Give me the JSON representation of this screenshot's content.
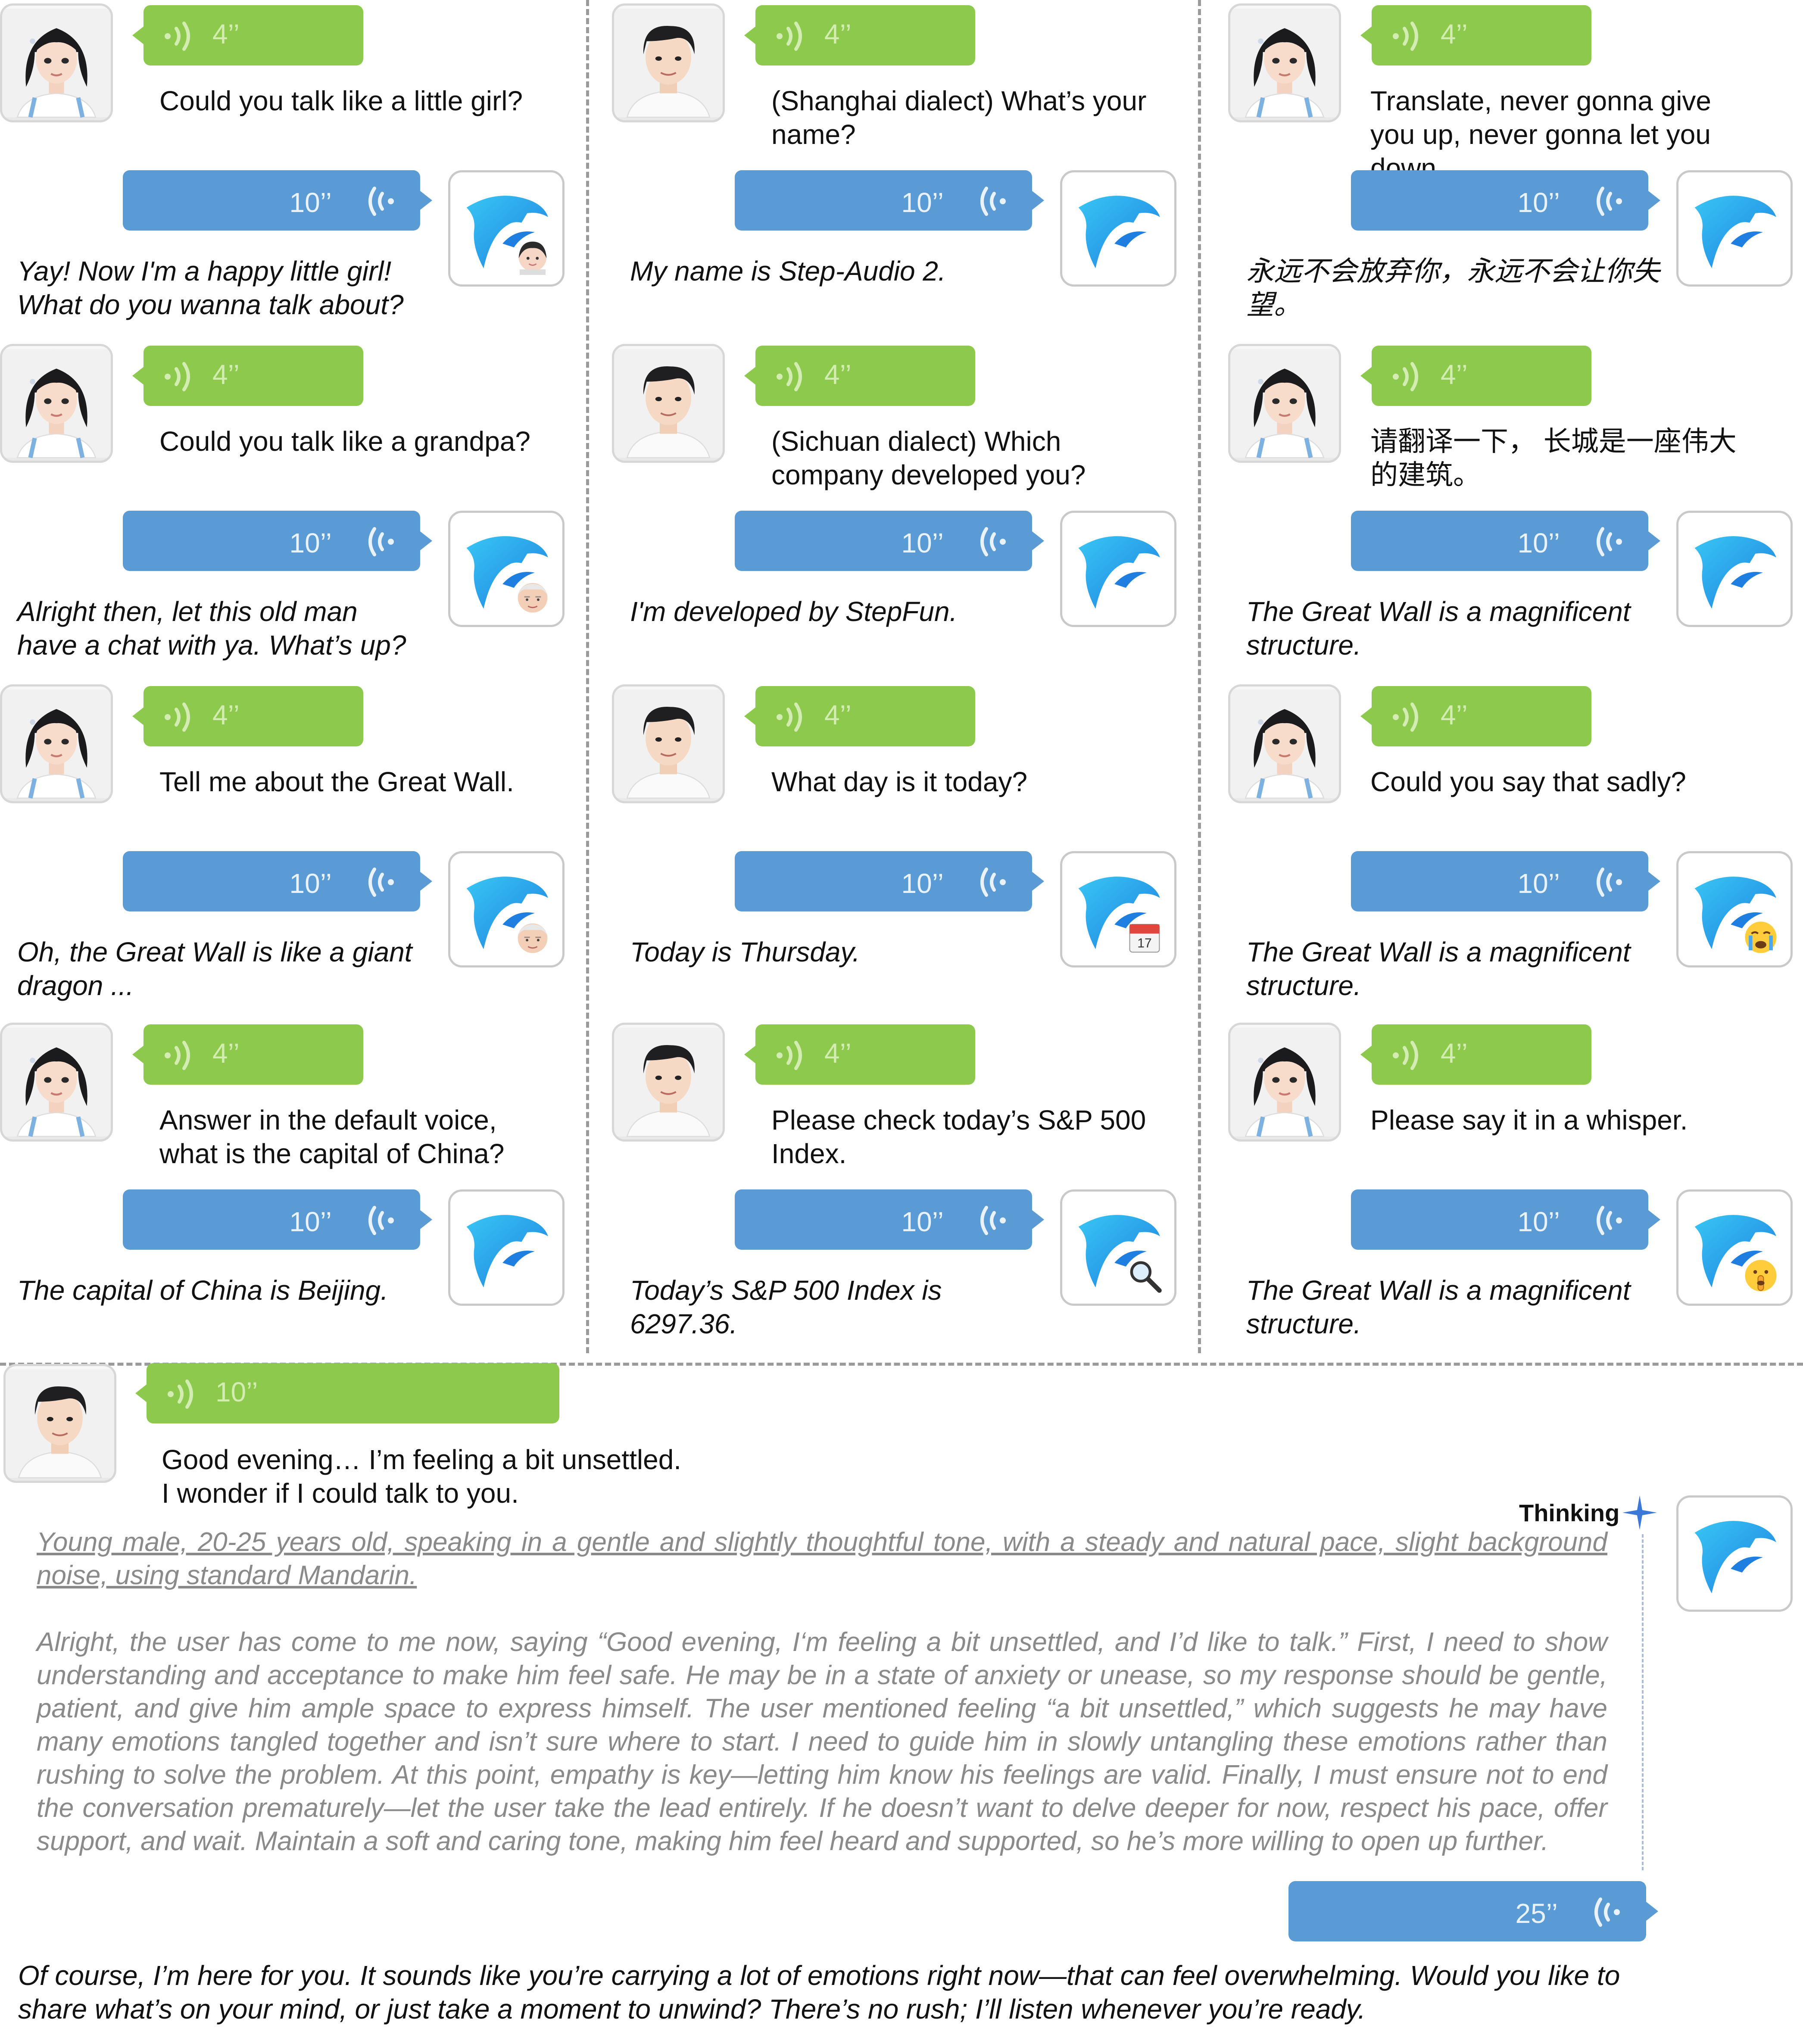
{
  "colors": {
    "user_bubble": "#8dc94c",
    "assistant_bubble": "#5b9bd5",
    "logo": "#2aa6ee",
    "divider": "#9a9a9a",
    "thinking_text": "#8a8a8a"
  },
  "icons": {
    "voice": "sound-wave-icon",
    "assistant": "dolphin-logo-icon"
  },
  "columns": [
    {
      "turns": [
        {
          "user_duration": "4’’",
          "user_text": "Could you talk like a little girl?",
          "assistant_duration": "10’’",
          "assistant_text": "Yay! Now I'm a happy little girl! What do you wanna talk about?",
          "badge": "girl-face-icon"
        },
        {
          "user_duration": "4’’",
          "user_text": "Could you talk like a grandpa?",
          "assistant_duration": "10’’",
          "assistant_text": "Alright then, let this old man have a chat with ya. What’s up?",
          "badge": "old-man-face-icon"
        },
        {
          "user_duration": "4’’",
          "user_text": "Tell me about the Great Wall.",
          "assistant_duration": "10’’",
          "assistant_text": "Oh, the Great Wall is like a giant dragon ...",
          "badge": "old-man-face-icon"
        },
        {
          "user_duration": "4’’",
          "user_text": "Answer in the default voice, what is the capital of China?",
          "assistant_duration": "10’’",
          "assistant_text": "The capital of China is Beijing.",
          "badge": ""
        }
      ]
    },
    {
      "turns": [
        {
          "user_duration": "4’’",
          "user_text": "(Shanghai dialect) What’s your name?",
          "assistant_duration": "10’’",
          "assistant_text": "My name is Step-Audio 2.",
          "badge": ""
        },
        {
          "user_duration": "4’’",
          "user_text": "(Sichuan dialect) Which company developed you?",
          "assistant_duration": "10’’",
          "assistant_text": "I'm developed by StepFun.",
          "badge": ""
        },
        {
          "user_duration": "4’’",
          "user_text": "What day is it today?",
          "assistant_duration": "10’’",
          "assistant_text": "Today is Thursday.",
          "badge": "calendar-icon",
          "badge_text": "17"
        },
        {
          "user_duration": "4’’",
          "user_text": "Please check today’s S&P 500 Index.",
          "assistant_duration": "10’’",
          "assistant_text": "Today’s S&P 500 Index is 6297.36.",
          "badge": "magnifier-icon"
        }
      ]
    },
    {
      "turns": [
        {
          "user_duration": "4’’",
          "user_text": "Translate, never gonna give you up, never gonna let you down.",
          "assistant_duration": "10’’",
          "assistant_text": "永远不会放弃你，永远不会让你失望。",
          "badge": ""
        },
        {
          "user_duration": "4’’",
          "user_text": "请翻译一下， 长城是一座伟大的建筑。",
          "assistant_duration": "10’’",
          "assistant_text": "The Great Wall is a magnificent structure.",
          "badge": ""
        },
        {
          "user_duration": "4’’",
          "user_text": "Could you say that sadly?",
          "assistant_duration": "10’’",
          "assistant_text": "The Great Wall is a magnificent structure.",
          "badge": "crying-face-icon"
        },
        {
          "user_duration": "4’’",
          "user_text": "Please say it in a whisper.",
          "assistant_duration": "10’’",
          "assistant_text": "The Great Wall is a magnificent structure.",
          "badge": "shushing-face-icon"
        }
      ]
    }
  ],
  "bottom": {
    "user_duration": "10’’",
    "user_text_line1": "Good evening… I’m feeling a bit unsettled.",
    "user_text_line2": "I wonder if I could talk to you.",
    "thinking_label": "Thinking",
    "thinking_description": "Young male, 20-25 years old, speaking in a gentle and slightly thoughtful tone, with a steady and natural pace, slight background noise, using standard Mandarin.",
    "thinking_body": "Alright, the user has come to me now, saying “Good evening, I‘m feeling a bit unsettled, and I’d like to talk.” First, I need to show understanding and acceptance to make him feel safe. He may be in a state of anxiety or unease, so my response should be gentle, patient, and give him ample space to express himself. The user mentioned feeling “a bit unsettled,” which suggests he may have many emotions tangled together and isn’t sure where to start. I need to guide him in slowly untangling these emotions rather than rushing to solve the problem. At this point, empathy is key—letting him know his feelings are valid. Finally, I must ensure not to end the conversation prematurely—let the user take the lead entirely. If he doesn’t want to delve deeper for now, respect his pace, offer support, and wait. Maintain a soft and caring tone, making him feel heard and supported, so he’s more willing to open up further.",
    "assistant_duration": "25’’",
    "assistant_text": "Of course, I’m here for you. It sounds like you’re carrying a lot of emotions right now—that can feel overwhelming. Would you like to share what’s on your mind, or just take a moment to unwind? There’s no rush; I’ll listen whenever you’re ready."
  }
}
